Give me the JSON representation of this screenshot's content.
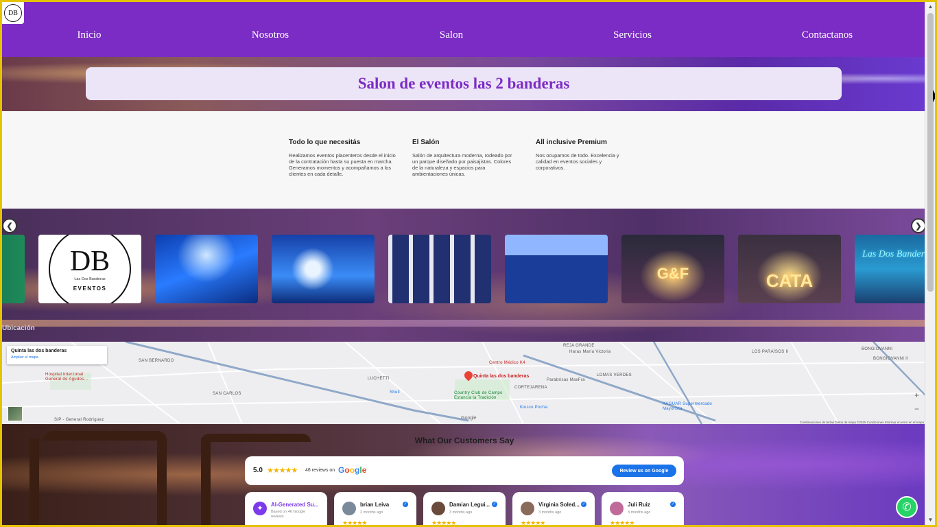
{
  "nav": {
    "logo_text": "DB",
    "items": [
      {
        "label": "Inicio"
      },
      {
        "label": "Nosotros"
      },
      {
        "label": "Salon"
      },
      {
        "label": "Servicios"
      },
      {
        "label": "Contactanos"
      }
    ]
  },
  "hero": {
    "title": "Salon de eventos las 2 banderas"
  },
  "features": [
    {
      "title": "Todo lo que necesitás",
      "text": "Realizamos eventos placenteros desde el inicio de la contratación hasta su puesta en marcha. Generamos momentos y acompañamos a los clientes en cada detalle."
    },
    {
      "title": "El Salón",
      "text": "Salón de arquitectura moderna, rodeado por un parque diseñado por paisajistas. Colores de la naturaleza y espacios para ambientaciones únicas."
    },
    {
      "title": "All inclusive Premium",
      "text": "Nos ocupamos de todo. Excelencia y calidad en eventos sociales y corporativos."
    }
  ],
  "gallery": {
    "prev_icon": "chevron-left-icon",
    "next_icon": "chevron-right-icon",
    "logo_mark": "DB",
    "logo_sub": "Las Dos Banderas",
    "logo_events": "EVENTOS",
    "sign_gf": "G&F",
    "sign_cata": "CATA",
    "sign_neon": "Las Dos Banderas Eve"
  },
  "location": {
    "label": "Ubicación",
    "card_title": "Quinta las dos banderas",
    "card_link": "Ampliar el mapa",
    "pin_label": "Quinta las dos banderas",
    "labels": {
      "san_bernardo": "SAN BERNARDO",
      "hospital": "Hospital Interzonal General de Agudos...",
      "san_carlos": "SAN CARLOS",
      "luchetti": "LUCHETTI",
      "shell": "Shell",
      "centro_medico": "Centro Médico K4",
      "reja_grande": "REJA GRANDE",
      "haras": "Haras María Victoria",
      "lomas_verdes": "LOMAS VERDES",
      "parabrisas": "Parabrisas MaxFra",
      "cortejarena": "CORTEJARENA",
      "country": "Country Club de Campo Estancia la Tradición",
      "kiosco": "Kiosco Pocha",
      "kaguar": "KAGUAR Supermercado Mayorista",
      "paraisos": "LOS PARAÍSOS II",
      "bongiovanni": "BONGIOVANNI",
      "bongiovanni2": "BONGIOVANNI II",
      "sip": "SIP - General Rodríguez"
    },
    "google": "Google",
    "zoom_in": "+",
    "zoom_out": "−",
    "footer": "Combinaciones de teclas   Datos de mapa ©2025   Condiciones   Informar un error en el mapa"
  },
  "reviews": {
    "title": "What Our Customers Say",
    "rating": "5.0",
    "stars": "★★★★★",
    "count": "46 reviews on",
    "google_letters": [
      "G",
      "o",
      "o",
      "g",
      "l",
      "e"
    ],
    "button": "Review us on Google",
    "ai_card": {
      "title": "AI-Generated Su...",
      "sub": "Based on 46 Google reviews",
      "icon": "sparkle-icon"
    },
    "cards": [
      {
        "name": "brian Leiva",
        "date": "2 months ago",
        "stars": "★★★★★",
        "avatar_color": "#7a8a9a"
      },
      {
        "name": "Damian Legui...",
        "date": "3 months ago",
        "stars": "★★★★★",
        "avatar_color": "#6a4a3a"
      },
      {
        "name": "Virginia Soled...",
        "date": "3 months ago",
        "stars": "★★★★★",
        "avatar_color": "#8a6a5a"
      },
      {
        "name": "Juli Ruiz",
        "date": "3 months ago",
        "stars": "★★★★★",
        "avatar_color": "#c06a9a"
      }
    ]
  },
  "whatsapp_icon": "whatsapp-icon"
}
